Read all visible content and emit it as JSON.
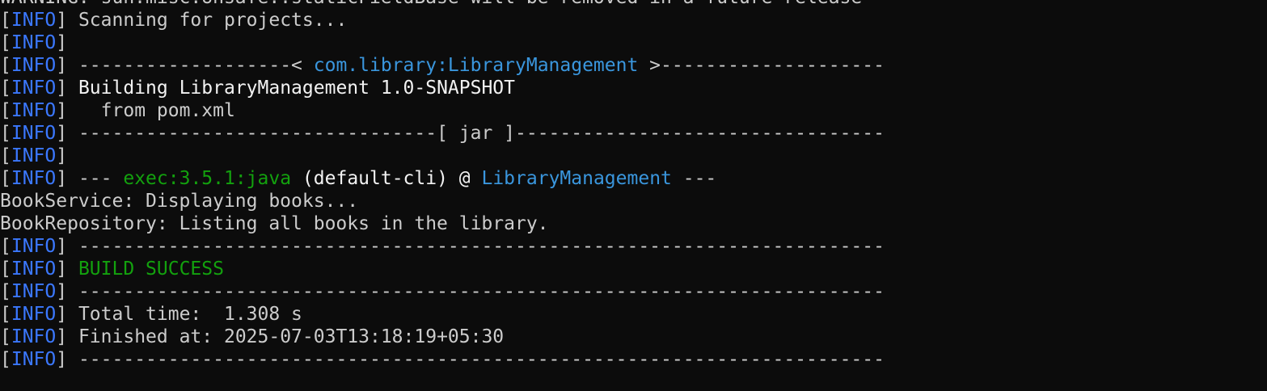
{
  "colors": {
    "background": "#0c0c0c",
    "foreground": "#cccccc",
    "info": "#3b78ff",
    "highlight_blue": "#3a96dd",
    "success_green": "#13a10e",
    "bright_white": "#f2f2f2"
  },
  "info_tag": "INFO",
  "lines": [
    {
      "type": "plain",
      "segments": [
        {
          "text": "WARNING: sun.misc.Unsafe::staticFieldBase will be removed in a future release",
          "color": "plain"
        }
      ]
    },
    {
      "type": "info",
      "segments": [
        {
          "text": " Scanning for projects...",
          "color": "plain"
        }
      ]
    },
    {
      "type": "info",
      "segments": []
    },
    {
      "type": "info",
      "segments": [
        {
          "text": " -------------------< ",
          "color": "plain"
        },
        {
          "text": "com.library:LibraryManagement",
          "color": "blue"
        },
        {
          "text": " >--------------------",
          "color": "plain"
        }
      ]
    },
    {
      "type": "info",
      "segments": [
        {
          "text": " Building LibraryManagement 1.0-SNAPSHOT",
          "color": "white"
        }
      ]
    },
    {
      "type": "info",
      "segments": [
        {
          "text": "   from pom.xml",
          "color": "plain"
        }
      ]
    },
    {
      "type": "info",
      "segments": [
        {
          "text": " --------------------------------[ jar ]---------------------------------",
          "color": "plain"
        }
      ]
    },
    {
      "type": "info",
      "segments": []
    },
    {
      "type": "info",
      "segments": [
        {
          "text": " --- ",
          "color": "plain"
        },
        {
          "text": "exec:3.5.1:java",
          "color": "green"
        },
        {
          "text": " (default-cli) @ ",
          "color": "white"
        },
        {
          "text": "LibraryManagement",
          "color": "blue"
        },
        {
          "text": " ---",
          "color": "plain"
        }
      ]
    },
    {
      "type": "plain",
      "segments": [
        {
          "text": "BookService: Displaying books...",
          "color": "plain"
        }
      ]
    },
    {
      "type": "plain",
      "segments": [
        {
          "text": "BookRepository: Listing all books in the library.",
          "color": "plain"
        }
      ]
    },
    {
      "type": "info",
      "segments": [
        {
          "text": " ------------------------------------------------------------------------",
          "color": "plain"
        }
      ]
    },
    {
      "type": "info",
      "segments": [
        {
          "text": " BUILD SUCCESS",
          "color": "green"
        }
      ]
    },
    {
      "type": "info",
      "segments": [
        {
          "text": " ------------------------------------------------------------------------",
          "color": "plain"
        }
      ]
    },
    {
      "type": "info",
      "segments": [
        {
          "text": " Total time:  1.308 s",
          "color": "plain"
        }
      ]
    },
    {
      "type": "info",
      "segments": [
        {
          "text": " Finished at: 2025-07-03T13:18:19+05:30",
          "color": "plain"
        }
      ]
    },
    {
      "type": "info",
      "segments": [
        {
          "text": " ------------------------------------------------------------------------",
          "color": "plain"
        }
      ]
    }
  ]
}
